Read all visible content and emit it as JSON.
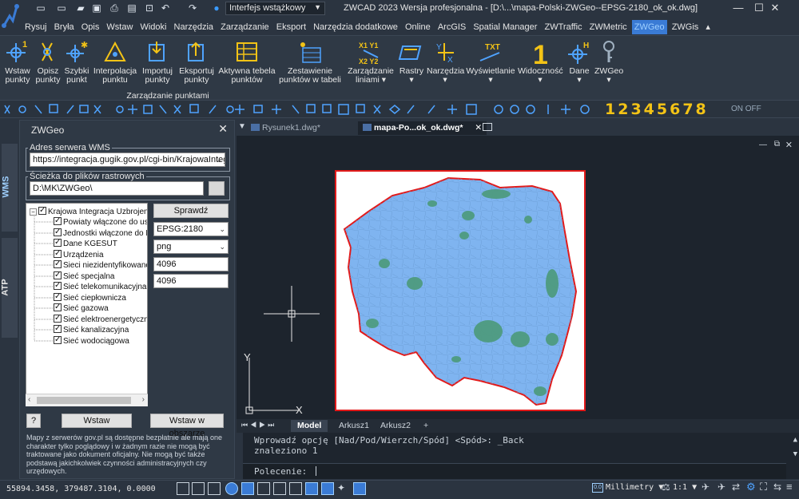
{
  "titlebar": {
    "workspace": "Interfejs wstążkowy",
    "title": "ZWCAD 2023 Wersja profesjonalna - [D:\\...\\mapa-Polski-ZWGeo--EPSG-2180_ok_ok.dwg]"
  },
  "menu": [
    "Rysuj",
    "Bryła",
    "Opis",
    "Wstaw",
    "Widoki",
    "Narzędzia",
    "Zarządzanie",
    "Eksport",
    "Narzędzia dodatkowe",
    "Online",
    "ArcGIS",
    "Spatial Manager",
    "ZWTraffic",
    "ZWMetric",
    "ZWGeo",
    "ZWGis"
  ],
  "ribbon": {
    "buttons": [
      {
        "l1": "Wstaw",
        "l2": "punkty"
      },
      {
        "l1": "Opisz",
        "l2": "punkty"
      },
      {
        "l1": "Szybki",
        "l2": "punkt"
      },
      {
        "l1": "Interpolacja",
        "l2": "punktu"
      },
      {
        "l1": "Importuj",
        "l2": "punkty"
      },
      {
        "l1": "Eksportuj",
        "l2": "punkty"
      },
      {
        "l1": "Aktywna tebela",
        "l2": "punktów"
      },
      {
        "l1": "Zestawienie",
        "l2": "punktów w tabeli"
      },
      {
        "l1": "Zarządzanie",
        "l2": "liniami ▾"
      },
      {
        "l1": "Rastry",
        "l2": "▾"
      },
      {
        "l1": "Narzędzia",
        "l2": "▾"
      },
      {
        "l1": "Wyświetlanie",
        "l2": "▾"
      },
      {
        "l1": "Widoczność",
        "l2": "▾"
      },
      {
        "l1": "Dane",
        "l2": "▾"
      },
      {
        "l1": "ZWGeo",
        "l2": "▾"
      }
    ],
    "group_label": "Zarządzanie punktami",
    "digits": "12345678",
    "onoff": "ON OFF"
  },
  "sidetabs": {
    "wms": "WMS",
    "atp": "ATP"
  },
  "panel": {
    "title": "ZWGeo",
    "wms_legend": "Adres serwera WMS",
    "wms_url": "https://integracja.gugik.gov.pl/cgi-bin/KrajowaIntegracja",
    "raster_legend": "Ścieżka do plików rastrowych",
    "raster_path": "D:\\MK\\ZWGeo\\",
    "tree_root": "Krajowa Integracja Uzbrojenia",
    "tree_items": [
      "Powiaty włączone do usług",
      "Jednostki włączone do KO",
      "Dane KGESUT",
      "Urządzenia",
      "Sieci niezidentyfikowane",
      "Sieć specjalna",
      "Sieć telekomunikacyjna",
      "Sieć ciepłownicza",
      "Sieć gazowa",
      "Sieć elektroenergetyczna",
      "Sieć kanalizacyjna",
      "Sieć wodociągowa"
    ],
    "check_button": "Sprawdź",
    "crs": "EPSG:2180",
    "format": "png",
    "width": "4096",
    "height": "4096",
    "help_button": "?",
    "insert_button": "Wstaw",
    "insert_area_button": "Wstaw w obszarze",
    "note": "Mapy z serwerów gov.pl są dostępne bezpłatnie ale mają one charakter tylko poglądowy i w żadnym razie nie mogą być traktowane jako dokument oficjalny. Nie mogą być także podstawą jakichkolwiek czynności administracyjnych czy urzędowych."
  },
  "doctabs": [
    {
      "label": "Rysunek1.dwg*"
    },
    {
      "label": "mapa-Po...ok_ok.dwg*"
    }
  ],
  "axis": {
    "x": "X",
    "y": "Y"
  },
  "layouttabs": [
    "Model",
    "Arkusz1",
    "Arkusz2",
    "+"
  ],
  "command": {
    "line1": "Wprowadź opcję [Nad/Pod/Wierzch/Spód] <Spód>: _Back",
    "line2": "znaleziono 1",
    "prompt": "Polecenie:"
  },
  "status": {
    "coords": "55894.3458, 379487.3104, 0.0000",
    "units": "Millimetry",
    "scale": "1:1"
  },
  "colors": {
    "accent": "#3a7bd5",
    "map_fill": "#7fb4f0",
    "map_border": "#e21a1a",
    "forest": "#4c9a7a",
    "digits": "#f3c316"
  }
}
